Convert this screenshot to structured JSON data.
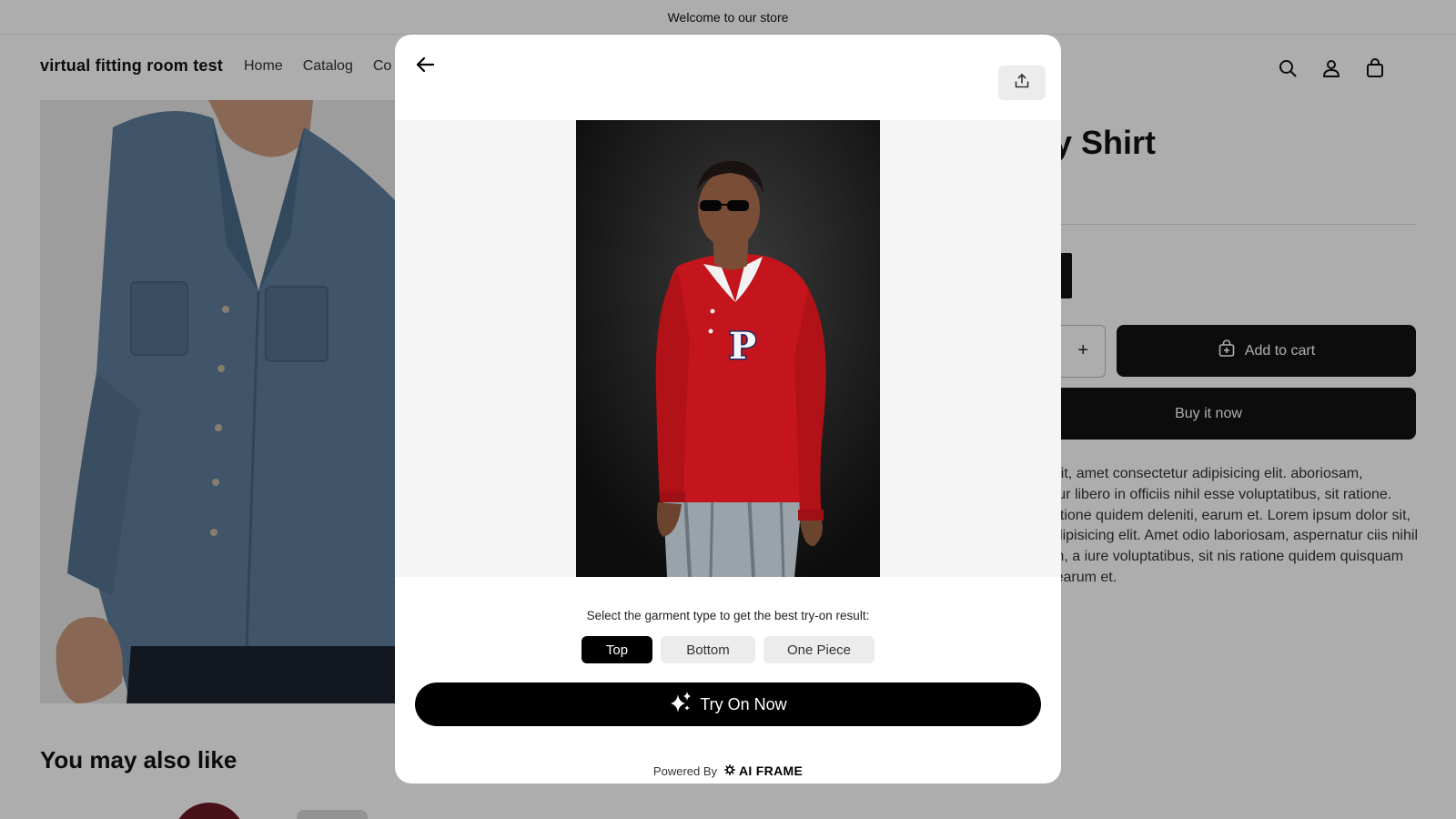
{
  "announcement": {
    "text": "Welcome to our store"
  },
  "header": {
    "logo": "virtual fitting room test",
    "nav": [
      "Home",
      "Catalog",
      "Co"
    ],
    "icons": [
      "search-icon",
      "account-icon",
      "cart-icon"
    ]
  },
  "product": {
    "title_visible": "uroy Shirt",
    "add_to_cart": "Add to cart",
    "buy_now": "Buy it now",
    "quantity_plus": "+",
    "description": "m dolor sit, amet consectetur adipisicing elit. aboriosam, aspernatur libero in officiis nihil esse voluptatibus, sit ratione. Omnis ratione quidem deleniti, earum et. Lorem ipsum dolor sit, amet r adipisicing elit. Amet odio laboriosam, aspernatur ciis nihil esse nam, a iure voluptatibus, sit nis ratione quidem quisquam deleniti, earum et."
  },
  "related": {
    "heading": "You may also like"
  },
  "modal": {
    "back_icon": "arrow-left-icon",
    "share_icon": "share-upload-icon",
    "garment_prompt": "Select the garment type to get the best try-on result:",
    "garment_options": [
      {
        "label": "Top",
        "selected": true
      },
      {
        "label": "Bottom",
        "selected": false
      },
      {
        "label": "One Piece",
        "selected": false
      }
    ],
    "try_on_label": "Try On Now",
    "powered_by": "Powered By",
    "brand": "AI FRAME"
  },
  "colors": {
    "accent": "#000000",
    "overlay": "rgba(0,0,0,0.32)",
    "sweater": "#c4151c",
    "denim_shirt": "#5f7e9d"
  }
}
